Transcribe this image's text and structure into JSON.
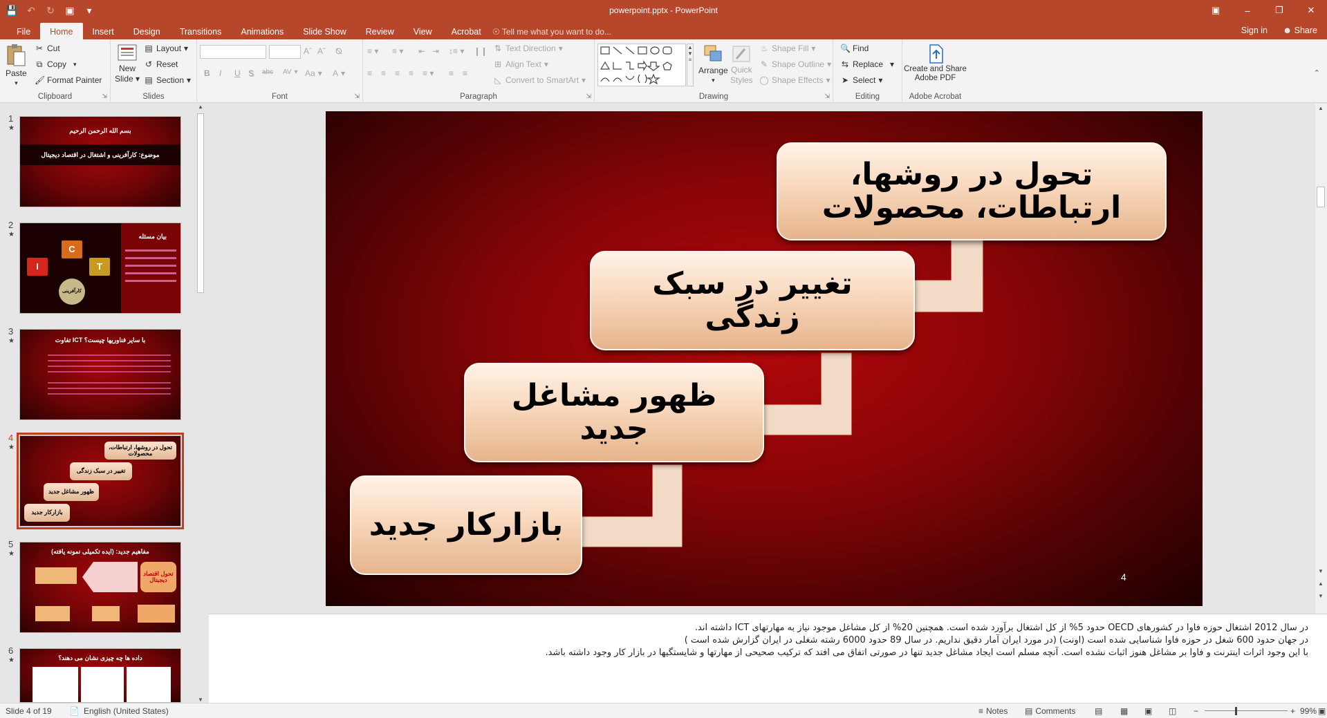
{
  "window": {
    "title": "powerpoint.pptx - PowerPoint",
    "accent": "#b7472a"
  },
  "quick_access": {
    "save_icon": "save-icon",
    "undo_icon": "undo-icon",
    "redo_icon": "redo-icon",
    "present_icon": "start-from-beginning-icon"
  },
  "tabs": [
    {
      "label": "File"
    },
    {
      "label": "Home"
    },
    {
      "label": "Insert"
    },
    {
      "label": "Design"
    },
    {
      "label": "Transitions"
    },
    {
      "label": "Animations"
    },
    {
      "label": "Slide Show"
    },
    {
      "label": "Review"
    },
    {
      "label": "View"
    },
    {
      "label": "Acrobat"
    }
  ],
  "tell_me": "Tell me what you want to do...",
  "account": {
    "sign_in": "Sign in",
    "share": "Share"
  },
  "ribbon": {
    "clipboard": {
      "label": "Clipboard",
      "paste": "Paste",
      "cut": "Cut",
      "copy": "Copy",
      "format_painter": "Format Painter"
    },
    "slides": {
      "label": "Slides",
      "new_slide": "New",
      "new_slide2": "Slide",
      "layout": "Layout",
      "reset": "Reset",
      "section": "Section"
    },
    "font": {
      "label": "Font",
      "bold": "B",
      "italic": "I",
      "underline": "U",
      "strike": "S",
      "shadow": "abc",
      "spacing": "AV",
      "case": "Aa",
      "color": "A"
    },
    "paragraph": {
      "label": "Paragraph",
      "text_direction": "Text Direction",
      "align_text": "Align Text",
      "smartart": "Convert to SmartArt"
    },
    "drawing": {
      "label": "Drawing",
      "arrange": "Arrange",
      "quick_styles": "Quick",
      "quick_styles2": "Styles",
      "shape_fill": "Shape Fill",
      "shape_outline": "Shape Outline",
      "shape_effects": "Shape Effects"
    },
    "editing": {
      "label": "Editing",
      "find": "Find",
      "replace": "Replace",
      "select": "Select"
    },
    "acrobat": {
      "label": "Adobe Acrobat",
      "create": "Create and Share",
      "create2": "Adobe PDF"
    }
  },
  "thumbnails": [
    {
      "num": "1",
      "star": "★",
      "title": "بسم الله الرحمن الرحيم",
      "subtitle": "موضوع: کارآفرینی و اشتغال در اقتصاد دیجیتال"
    },
    {
      "num": "2",
      "star": "★",
      "title": "بیان مسئله",
      "c": "C",
      "i": "I",
      "t": "T",
      "center": "کارآفرینی"
    },
    {
      "num": "3",
      "star": "★",
      "title": "تفاوت ICT با سایر فناوریها چیست؟"
    },
    {
      "num": "4",
      "star": "★",
      "boxes": [
        "تحول در روشها، ارتباطات، محصولات",
        "تغییر در سبک زندگی",
        "ظهور مشاغل جدید",
        "بازارکار جدید"
      ]
    },
    {
      "num": "5",
      "star": "★",
      "title": "مفاهیم جدید: (ایده تکمیلی نمونه یافته)",
      "box": "تحول اقتصاد دیجیتال"
    },
    {
      "num": "6",
      "star": "★",
      "title": "داده ها چه چیزی نشان می دهند؟"
    }
  ],
  "slide": {
    "boxes": [
      "تحول در روشها، ارتباطات، محصولات",
      "تغییر در سبک زندگی",
      "ظهور مشاغل جدید",
      "بازارکار جدید"
    ],
    "number": "4"
  },
  "notes": [
    "در سال 2012 اشتغال حوزه فاوا در کشورهای OECD حدود 5% از کل اشتغال برآورد شده است. همچنین 20% از کل مشاغل موجود نیاز به مهارتهای ICT داشته اند.",
    "در جهان حدود 600 شغل در حوزه فاوا شناسایی شده است (اونت) (در مورد ایران آمار دقیق نداریم. در سال 89 حدود 6000 رشته شغلی در ایران گزارش شده است )",
    "با این وجود اثرات اینترنت و فاوا بر مشاغل هنوز اثبات نشده است. آنچه مسلم است ایجاد مشاغل جدید تنها در صورتی اتفاق می افتد که ترکیب صحیحی از مهارتها و شایستگیها در بازار کار وجود داشته باشد."
  ],
  "status": {
    "slide_of": "Slide 4 of 19",
    "language": "English (United States)",
    "notes": "Notes",
    "comments": "Comments",
    "zoom": "99%"
  }
}
